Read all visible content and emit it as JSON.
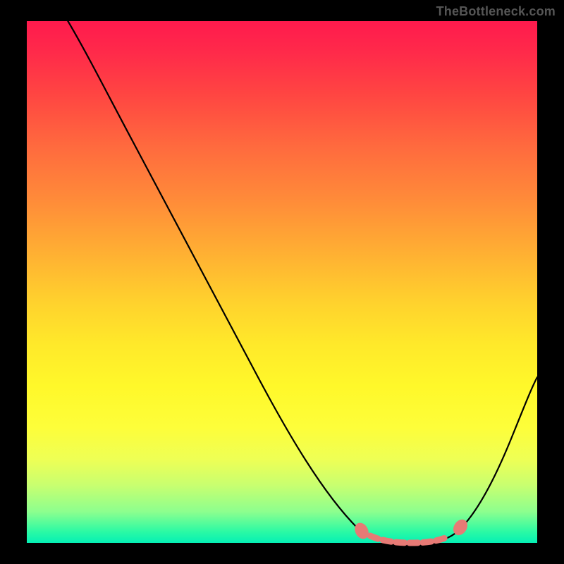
{
  "watermark": "TheBottleneck.com",
  "colors": {
    "background": "#000000",
    "curve": "#000000",
    "marker": "#e77a75"
  },
  "chart_data": {
    "type": "line",
    "x": [
      0.0,
      0.05,
      0.1,
      0.15,
      0.2,
      0.25,
      0.3,
      0.35,
      0.4,
      0.45,
      0.5,
      0.55,
      0.6,
      0.65,
      0.7,
      0.725,
      0.75,
      0.775,
      0.8,
      0.825,
      0.85,
      0.9,
      0.95,
      1.0
    ],
    "values": [
      1.02,
      0.94,
      0.85,
      0.76,
      0.67,
      0.58,
      0.5,
      0.4,
      0.31,
      0.24,
      0.18,
      0.12,
      0.075,
      0.035,
      0.01,
      0.0025,
      0.0,
      0.0015,
      0.0065,
      0.02,
      0.046,
      0.125,
      0.215,
      0.312
    ],
    "title": "",
    "xlabel": "",
    "ylabel": "",
    "xlim": [
      0,
      1
    ],
    "ylim": [
      0,
      1
    ],
    "annotations": {
      "highlight_range_x": [
        0.647,
        0.87
      ],
      "highlight_segment": "dashed marker along curve minimum"
    }
  }
}
